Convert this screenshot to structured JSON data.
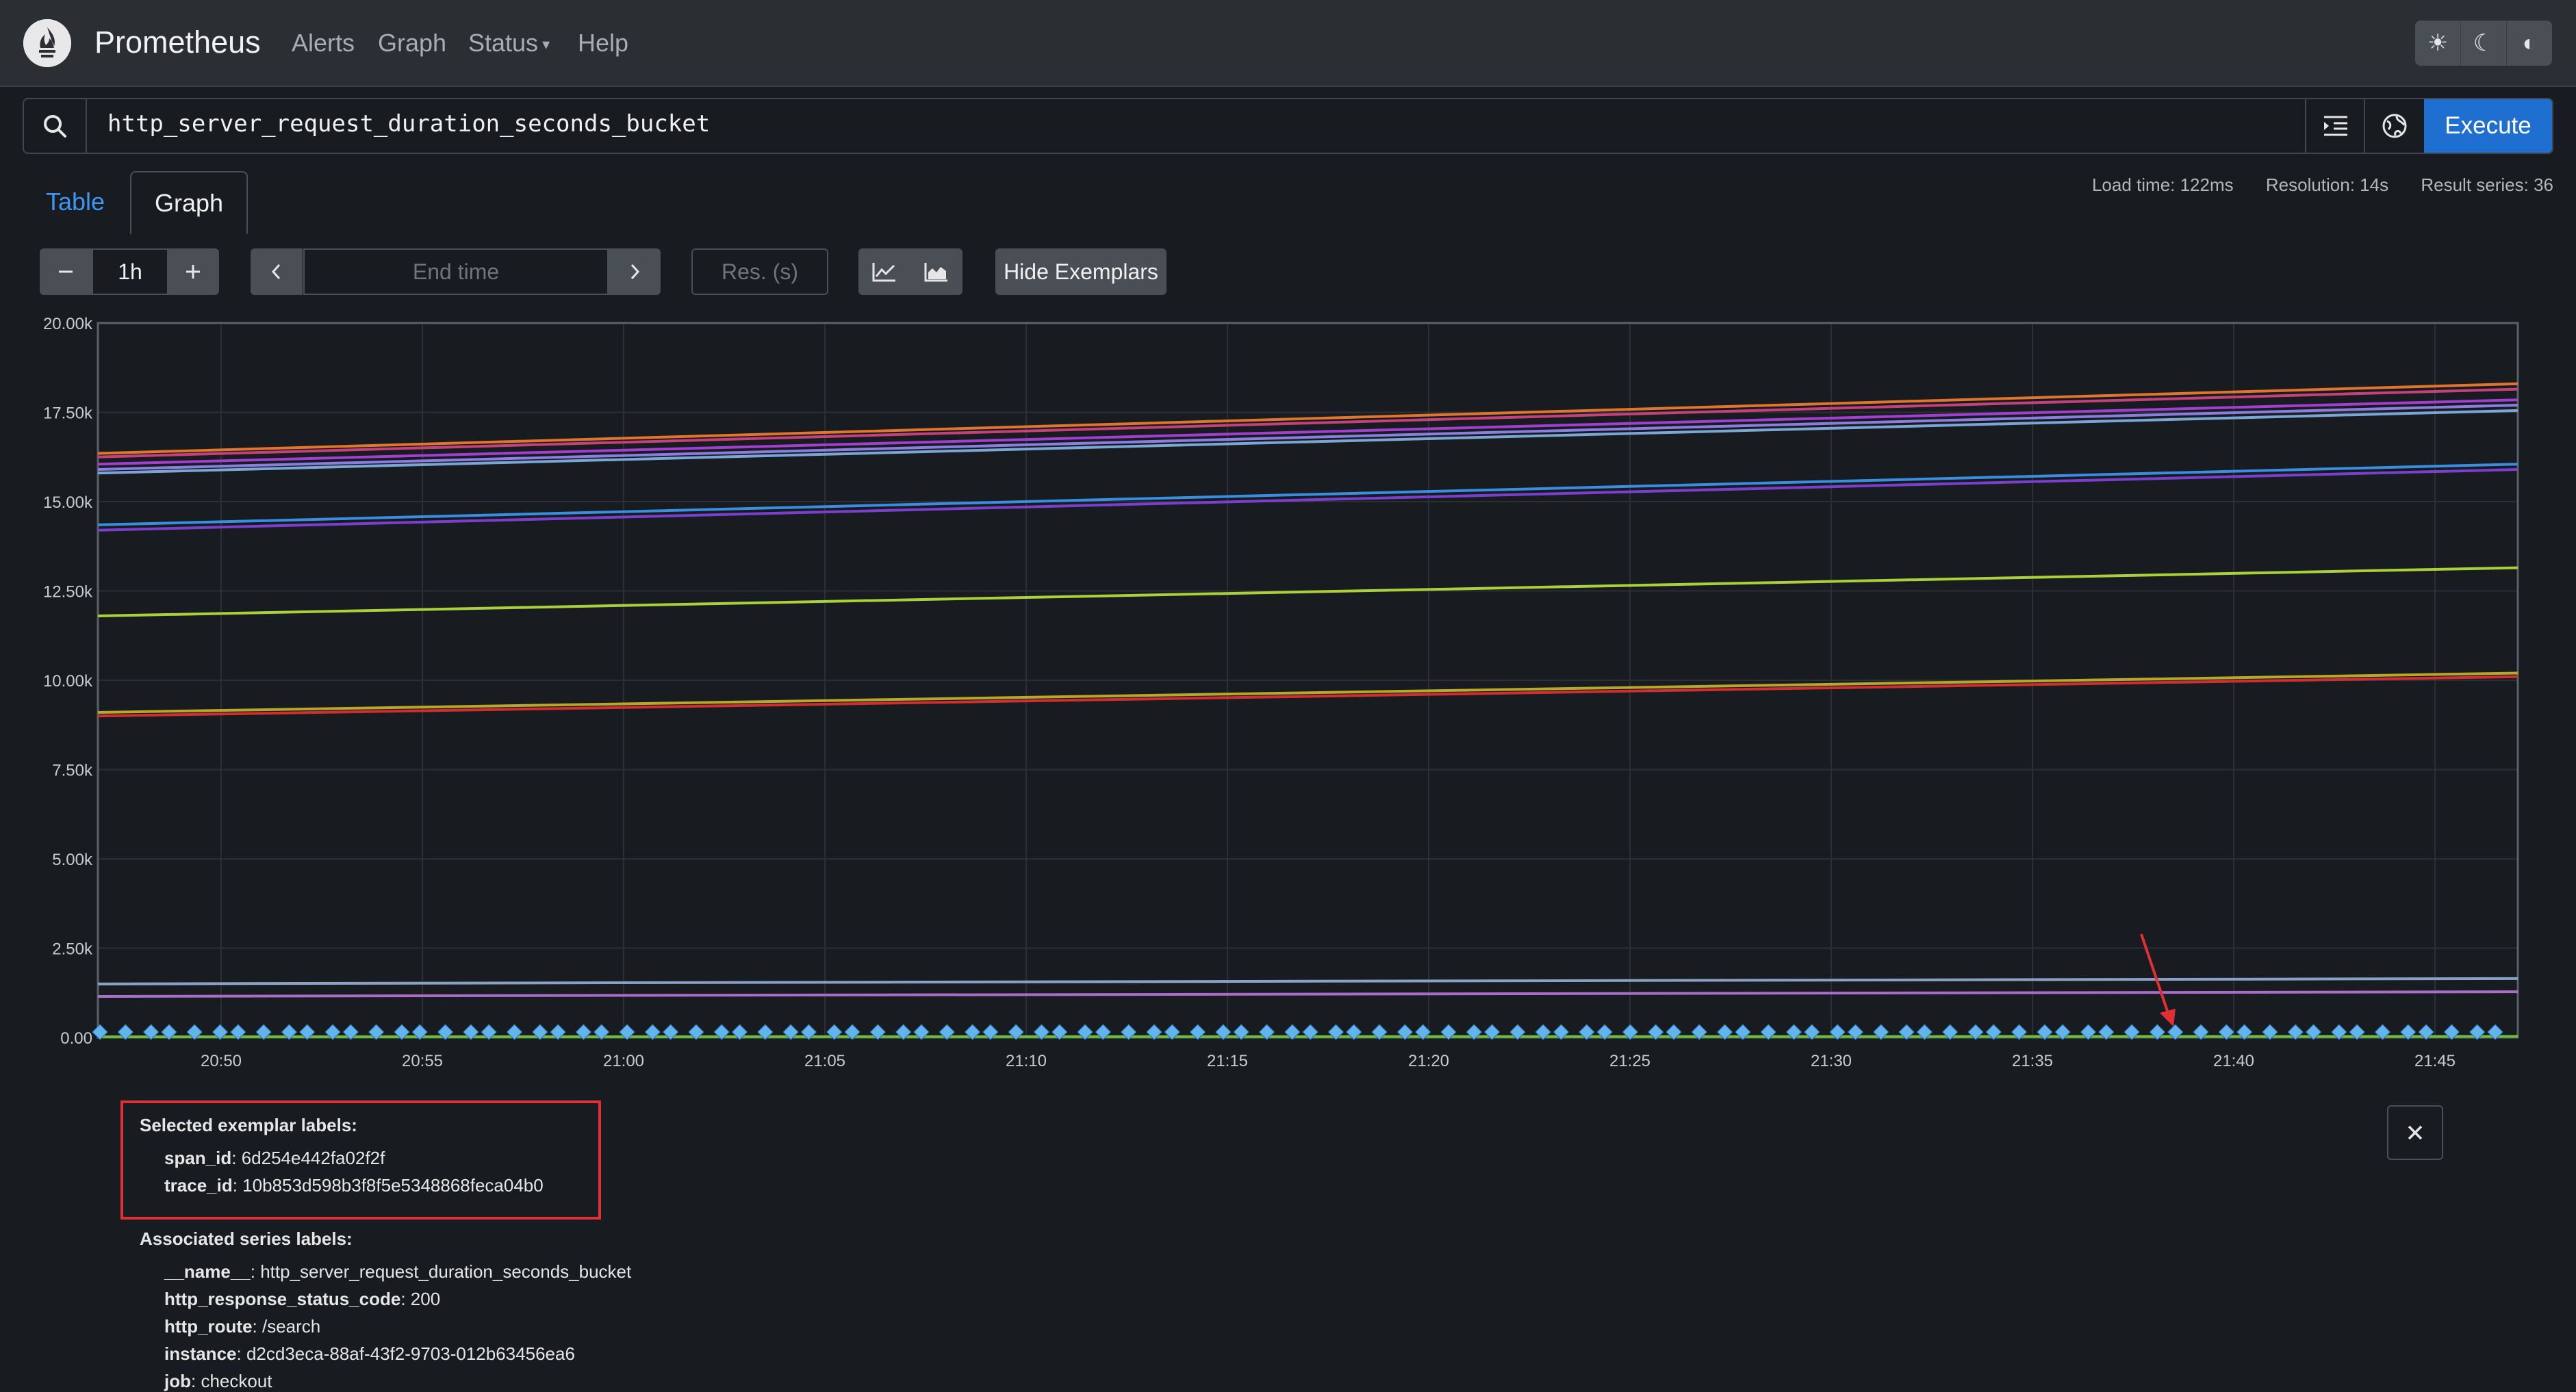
{
  "navbar": {
    "brand": "Prometheus",
    "links": [
      "Alerts",
      "Graph",
      "Status",
      "Help"
    ],
    "theme_icons": [
      "sun-icon",
      "moon-icon",
      "contrast-icon"
    ]
  },
  "query": {
    "expression": "http_server_request_duration_seconds_bucket",
    "execute_label": "Execute"
  },
  "tabs": [
    "Table",
    "Graph"
  ],
  "stats": {
    "load_time": "Load time: 122ms",
    "resolution": "Resolution: 14s",
    "result_series": "Result series: 36"
  },
  "controls": {
    "range": "1h",
    "end_time_placeholder": "End time",
    "res_placeholder": "Res. (s)",
    "hide_exemplars": "Hide Exemplars"
  },
  "chart_data": {
    "type": "line",
    "y_ticks": [
      "20.00k",
      "17.50k",
      "15.00k",
      "12.50k",
      "10.00k",
      "7.50k",
      "5.00k",
      "2.50k",
      "0.00"
    ],
    "x_ticks": [
      "20:50",
      "20:55",
      "21:00",
      "21:05",
      "21:10",
      "21:15",
      "21:20",
      "21:25",
      "21:30",
      "21:35",
      "21:40",
      "21:45"
    ],
    "ylim": [
      0,
      20000
    ],
    "grid": true,
    "series": [
      {
        "color": "#e0752d",
        "values": [
          16350,
          18300
        ]
      },
      {
        "color": "#c4417c",
        "values": [
          16250,
          18150
        ]
      },
      {
        "color": "#a23fd0",
        "values": [
          16050,
          17850
        ]
      },
      {
        "color": "#8c7ee0",
        "values": [
          15900,
          17700
        ]
      },
      {
        "color": "#7aa6d6",
        "values": [
          15800,
          17550
        ]
      },
      {
        "color": "#3a8ee0",
        "values": [
          14350,
          16050
        ]
      },
      {
        "color": "#7b3fd0",
        "values": [
          14200,
          15900
        ]
      },
      {
        "color": "#a9d13a",
        "values": [
          11800,
          13150
        ]
      },
      {
        "color": "#b7a72a",
        "values": [
          9100,
          10200
        ]
      },
      {
        "color": "#d12f2f",
        "values": [
          9000,
          10100
        ]
      },
      {
        "color": "#8aa1c7",
        "values": [
          1500,
          1650
        ]
      },
      {
        "color": "#a86ec9",
        "values": [
          1150,
          1280
        ]
      },
      {
        "color": "#6bbf3a",
        "values": [
          20,
          30
        ]
      }
    ],
    "exemplar_count": 106,
    "exemplar_color": "#63b3ed"
  },
  "exemplar": {
    "selected_title": "Selected exemplar labels:",
    "selected": [
      {
        "key": "span_id",
        "value": ": 6d254e442fa02f2f"
      },
      {
        "key": "trace_id",
        "value": ": 10b853d598b3f8f5e5348868feca04b0"
      }
    ],
    "series_title": "Associated series labels:",
    "series": [
      {
        "key": "__name__",
        "value": ": http_server_request_duration_seconds_bucket"
      },
      {
        "key": "http_response_status_code",
        "value": ": 200"
      },
      {
        "key": "http_route",
        "value": ": /search"
      },
      {
        "key": "instance",
        "value": ": d2cd3eca-88af-43f2-9703-012b63456ea6"
      },
      {
        "key": "job",
        "value": ": checkout"
      }
    ]
  }
}
